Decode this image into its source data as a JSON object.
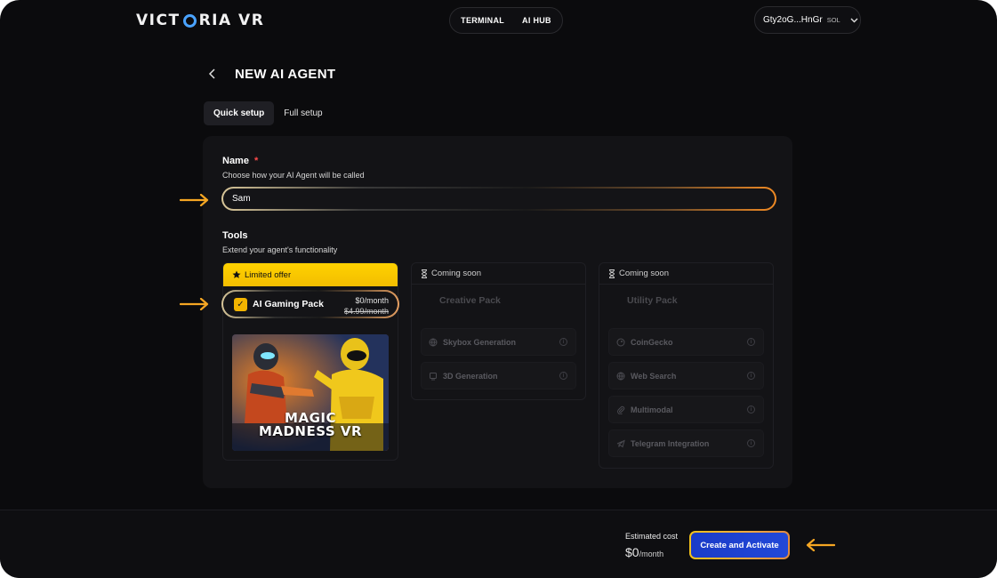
{
  "header": {
    "logo": {
      "part1": "VICT",
      "part2": "RIA VR"
    },
    "nav": [
      "TERMINAL",
      "AI HUB"
    ],
    "wallet": {
      "address": "Gty2oG...HnGr",
      "chain": "SOL"
    }
  },
  "page": {
    "title": "NEW AI AGENT",
    "tabs": [
      {
        "label": "Quick setup",
        "active": true
      },
      {
        "label": "Full setup",
        "active": false
      }
    ]
  },
  "form": {
    "name_label": "Name",
    "name_required": "*",
    "name_hint": "Choose how your AI Agent will be called",
    "name_value": "Sam",
    "tools_label": "Tools",
    "tools_hint": "Extend your agent's functionality"
  },
  "packs": {
    "gaming": {
      "badge": "Limited offer",
      "name": "AI Gaming Pack",
      "price": "$0/month",
      "old_price": "$4.99/month",
      "checked": true,
      "art_line1": "MAGIC",
      "art_line2": "MADNESS VR"
    },
    "creative": {
      "badge": "Coming soon",
      "name": "Creative Pack",
      "tools": [
        "Skybox Generation",
        "3D Generation"
      ]
    },
    "utility": {
      "badge": "Coming soon",
      "name": "Utility Pack",
      "tools": [
        "CoinGecko",
        "Web Search",
        "Multimodal",
        "Telegram Integration"
      ]
    }
  },
  "footer": {
    "estimated_label": "Estimated cost",
    "estimated_value": "$0",
    "estimated_unit": "/month",
    "create_button": "Create and Activate"
  },
  "colors": {
    "accent_yellow": "#ffd200",
    "accent_orange": "#f5a623",
    "button_blue": "#1f44d4",
    "background": "#0b0b0d"
  }
}
